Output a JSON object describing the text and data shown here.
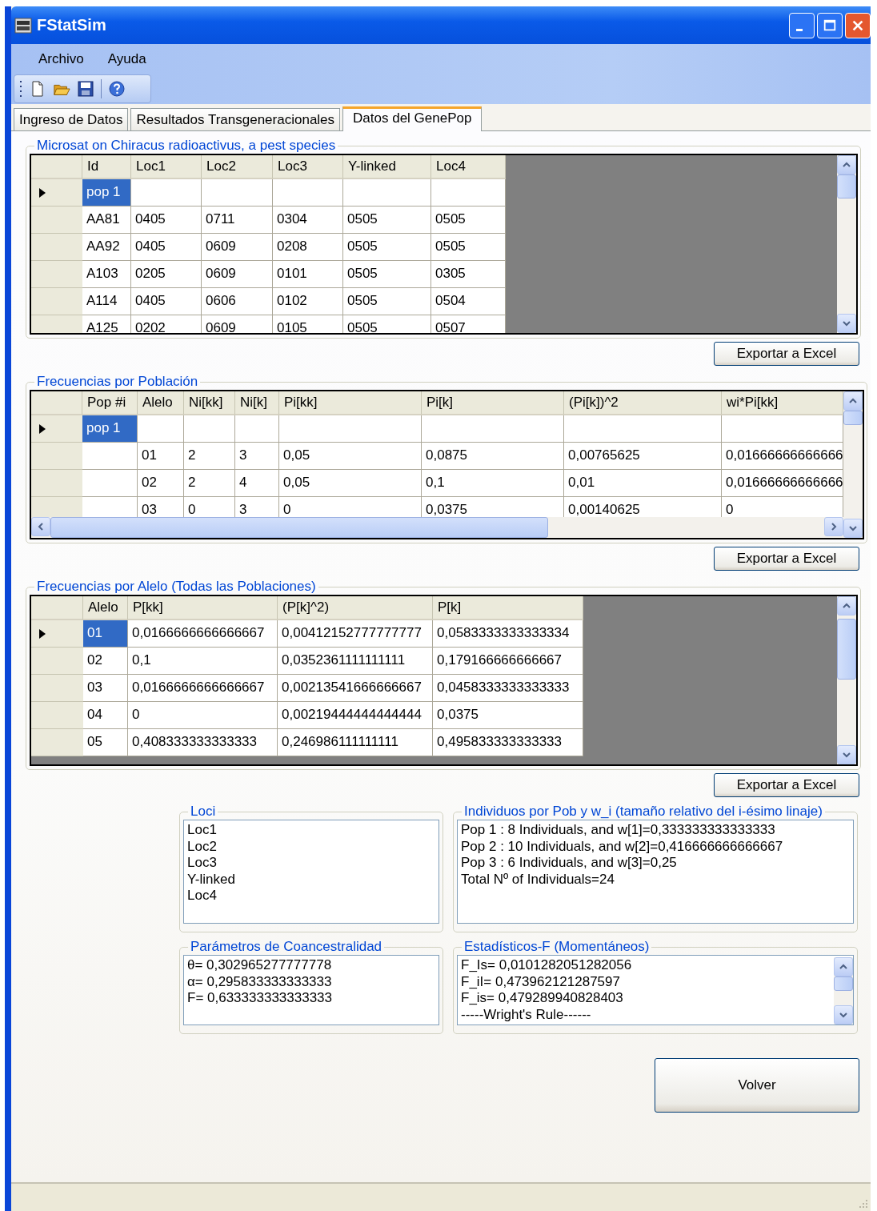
{
  "window": {
    "title": "FStatSim"
  },
  "menu": [
    "Archivo",
    "Ayuda"
  ],
  "tabs": [
    {
      "label": "Ingreso de Datos",
      "selected": false
    },
    {
      "label": "Resultados Transgeneracionales",
      "selected": false
    },
    {
      "label": "Datos del GenePop",
      "selected": true
    }
  ],
  "grids": [
    {
      "title": "Microsat on Chiracus radioactivus, a pest species",
      "columns": [
        "Id",
        "Loc1",
        "Loc2",
        "Loc3",
        "Y-linked",
        "Loc4"
      ],
      "rows": [
        {
          "kind": "group",
          "selected": true,
          "label": "pop 1"
        },
        {
          "kind": "data",
          "selected": false,
          "cells": [
            "AA81",
            "0405",
            "0711",
            "0304",
            "0505",
            "0505"
          ]
        },
        {
          "kind": "data",
          "selected": false,
          "cells": [
            "AA92",
            "0405",
            "0609",
            "0208",
            "0505",
            "0505"
          ]
        },
        {
          "kind": "data",
          "selected": false,
          "cells": [
            "A103",
            "0205",
            "0609",
            "0101",
            "0505",
            "0305"
          ]
        },
        {
          "kind": "data",
          "selected": false,
          "cells": [
            "A114",
            "0405",
            "0606",
            "0102",
            "0505",
            "0504"
          ]
        },
        {
          "kind": "data",
          "selected": false,
          "cells": [
            "A125",
            "0202",
            "0609",
            "0105",
            "0505",
            "0507"
          ]
        }
      ],
      "export_button": "Exportar a Excel"
    },
    {
      "title": "Frecuencias por Población",
      "columns": [
        "Pop #i",
        "Alelo",
        "Ni[kk]",
        "Ni[k]",
        "Pi[kk]",
        "Pi[k]",
        "(Pi[k])^2",
        "wi*Pi[kk]"
      ],
      "rows": [
        {
          "kind": "group",
          "selected": true,
          "label": "pop 1"
        },
        {
          "kind": "data",
          "selected": false,
          "cells": [
            null,
            "01",
            "2",
            "3",
            "0,05",
            "0,0875",
            "0,00765625",
            "0,01666666666666"
          ]
        },
        {
          "kind": "data",
          "selected": false,
          "cells": [
            null,
            "02",
            "2",
            "4",
            "0,05",
            "0,1",
            "0,01",
            "0,01666666666666"
          ]
        },
        {
          "kind": "data",
          "selected": false,
          "cells": [
            null,
            "03",
            "0",
            "3",
            "0",
            "0,0375",
            "0,00140625",
            "0"
          ]
        }
      ],
      "export_button": "Exportar a Excel"
    },
    {
      "title": "Frecuencias por Alelo (Todas las Poblaciones)",
      "columns": [
        "Alelo",
        "P[kk]",
        "(P[k]^2)",
        "P[k]"
      ],
      "rows": [
        {
          "kind": "data",
          "selected": true,
          "cells": [
            "01",
            "0,0166666666666667",
            "0,00412152777777777",
            "0,0583333333333334"
          ]
        },
        {
          "kind": "data",
          "selected": false,
          "cells": [
            "02",
            "0,1",
            "0,0352361111111111",
            "0,179166666666667"
          ]
        },
        {
          "kind": "data",
          "selected": false,
          "cells": [
            "03",
            "0,0166666666666667",
            "0,00213541666666667",
            "0,0458333333333333"
          ]
        },
        {
          "kind": "data",
          "selected": false,
          "cells": [
            "04",
            "0",
            "0,00219444444444444",
            "0,0375"
          ]
        },
        {
          "kind": "data",
          "selected": false,
          "cells": [
            "05",
            "0,408333333333333",
            "0,246986111111111",
            "0,495833333333333"
          ]
        }
      ],
      "export_button": "Exportar a Excel"
    }
  ],
  "loci": {
    "title": "Loci",
    "items": [
      "Loc1",
      "Loc2",
      "Loc3",
      "Y-linked",
      "Loc4"
    ]
  },
  "individuals": {
    "title": "Individuos por Pob y w_i (tamaño relativo del i-ésimo linaje)",
    "lines": [
      "Pop 1 : 8 Individuals, and w[1]=0,333333333333333",
      "Pop 2 : 10 Individuals, and w[2]=0,416666666666667",
      "Pop 3 : 6 Individuals, and w[3]=0,25",
      "Total Nº of Individuals=24"
    ]
  },
  "coancestry": {
    "title": "Parámetros de Coancestralidad",
    "lines": [
      "θ= 0,302965277777778",
      "α= 0,295833333333333",
      "F= 0,633333333333333"
    ]
  },
  "f_statistics": {
    "title": "Estadísticos-F (Momentáneos)",
    "lines": [
      "F_Is= 0,0101282051282056",
      "F_iI= 0,473962121287597",
      "F_is= 0,479289940828403",
      "-----Wright's Rule------"
    ]
  },
  "back_button": "Volver"
}
